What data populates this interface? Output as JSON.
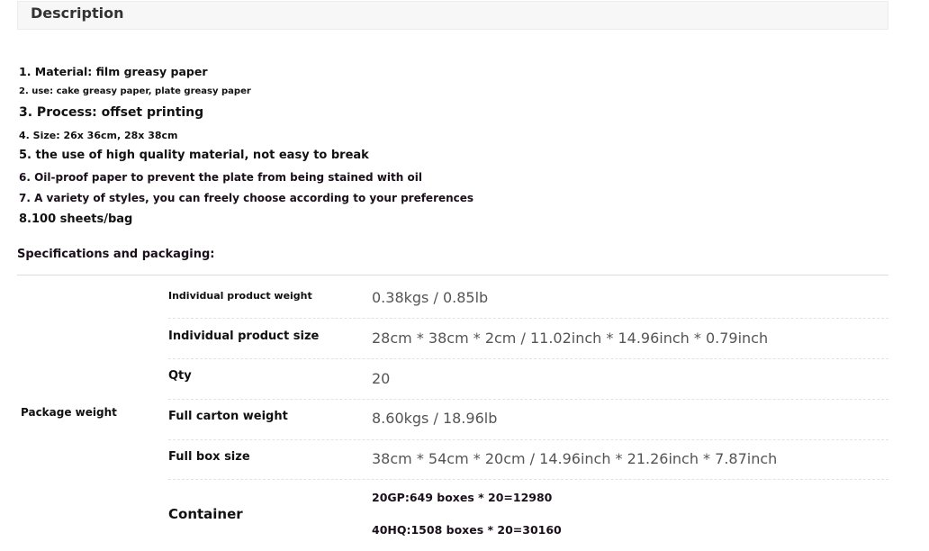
{
  "description": {
    "title": "Description",
    "lines": [
      "1. Material: film greasy paper",
      "2. use: cake greasy paper, plate greasy paper",
      "3. Process: offset printing",
      "4. Size: 26x 36cm, 28x 38cm",
      "5. the use of high quality material, not easy to break",
      "6. Oil-proof paper to prevent the plate from being stained with oil",
      "7. A variety of styles, you can freely choose according to your preferences",
      "8.100 sheets/bag"
    ]
  },
  "specs": {
    "title": "Specifications and packaging:",
    "group_label": "Package weight",
    "rows": [
      {
        "label": "Individual product weight",
        "value": "0.38kgs / 0.85lb"
      },
      {
        "label": "Individual product size",
        "value": "28cm * 38cm * 2cm / 11.02inch * 14.96inch * 0.79inch"
      },
      {
        "label": "Qty",
        "value": "20"
      },
      {
        "label": "Full carton weight",
        "value": "8.60kgs / 18.96lb"
      },
      {
        "label": "Full box size",
        "value": "38cm * 54cm * 20cm / 14.96inch * 21.26inch * 7.87inch"
      }
    ],
    "container": {
      "label": "Container",
      "values": [
        "20GP:649 boxes * 20=12980",
        "40HQ:1508 boxes * 20=30160"
      ]
    }
  }
}
